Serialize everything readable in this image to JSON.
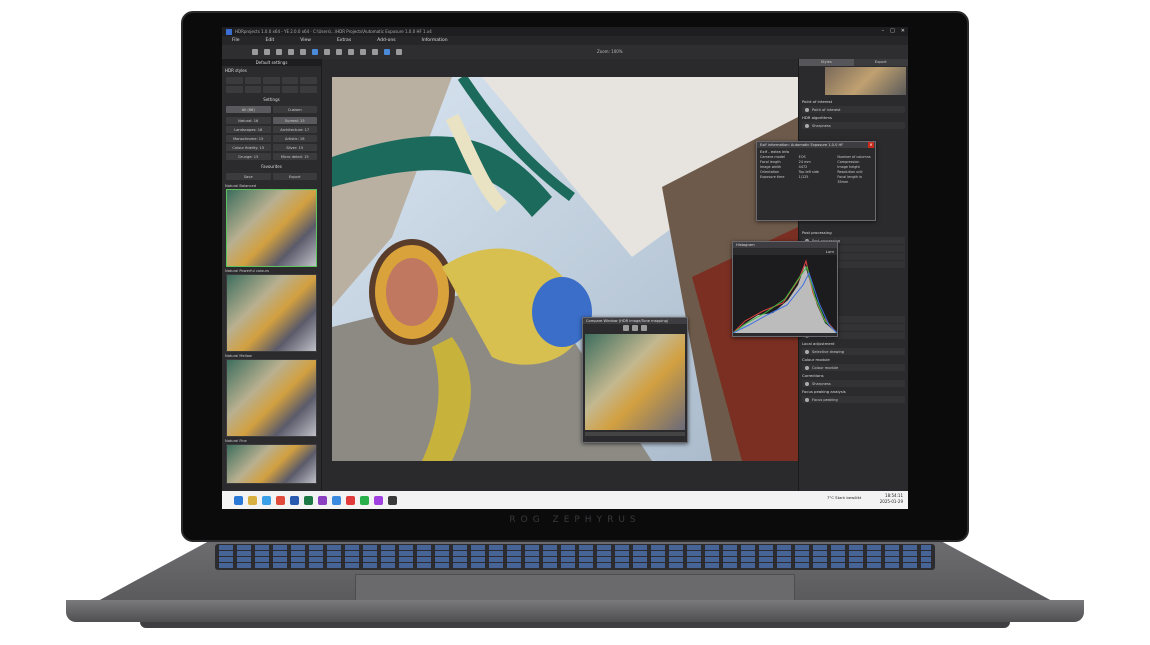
{
  "device": {
    "brand": "ROG ZEPHYRUS"
  },
  "app": {
    "window_title": "HDRprojects 1.0.0 x64 - YE 2.0.0 x64 · C:\\Users\\...\\HDR Projects\\Automatic Exposure 1.0.0 HF 1.x4",
    "menu": [
      "File",
      "Edit",
      "View",
      "Extras",
      "Add-ons",
      "Information"
    ],
    "zoom": "Zoom: 100%"
  },
  "left_panel": {
    "header": "Default settings",
    "styles_label": "HDR styles",
    "settings_label": "Settings",
    "tabs": [
      "All (68)",
      "Custom"
    ],
    "categories": [
      [
        "Natural: 16",
        "Surreal: 15"
      ],
      [
        "Landscapes: 16",
        "Architecture: 17"
      ],
      [
        "Monochrome: 15",
        "Artistic: 16"
      ],
      [
        "Colour fidelity: 15",
        "Silver: 15"
      ],
      [
        "Grunge: 15",
        "Micro detail: 15"
      ]
    ],
    "favourites_label": "Favourites",
    "export_buttons": [
      "Save",
      "Export"
    ],
    "thumbnails": [
      "Natural Balanced",
      "Natural Powerful colours",
      "Natural Mellow",
      "Natural Fine"
    ]
  },
  "right_panel": {
    "tabs": [
      "Styles",
      "Export"
    ],
    "sections": [
      "Point of interest",
      "HDR algorithms",
      "Post processing",
      "Film grain",
      "Local adjustment",
      "Colour module",
      "Corrections",
      "Focus peaking analysis"
    ],
    "rows": [
      "Point of interest",
      "Sharpness",
      "Post processing",
      "Finish colour",
      "Vignetting",
      "Dynamic",
      "Film grain",
      "Natural grain",
      "Fractal grain",
      "Selective drawing",
      "Colour module",
      "Sharpness",
      "Focus peaking"
    ]
  },
  "exif_window": {
    "title": "Exif information: Automatic Exposure 1.0.0 HF",
    "tab": "Exif - extra info",
    "rows": [
      [
        "Camera model",
        "EOS",
        "Number of columns"
      ],
      [
        "Focal length",
        "24 mm",
        "Compression"
      ],
      [
        "Image width",
        "4472",
        "Image height"
      ],
      [
        "Orientation",
        "Top left side",
        "Resolution unit"
      ],
      [
        "Exposure time",
        "1/125",
        "Focal length in 35mm"
      ]
    ]
  },
  "histogram_window": {
    "title": "Histogram",
    "scale_label": "Lum"
  },
  "compare_window": {
    "title": "Compare Window (HDR image/Tone mapping)"
  },
  "taskbar": {
    "weather": "7°C Stark bewölkt",
    "time": "18:54:11",
    "date": "2025-01-29"
  },
  "colors": {
    "accent": "#4a8ad8",
    "selected_thumb": "#5bc35b",
    "close": "#c42b1c"
  }
}
